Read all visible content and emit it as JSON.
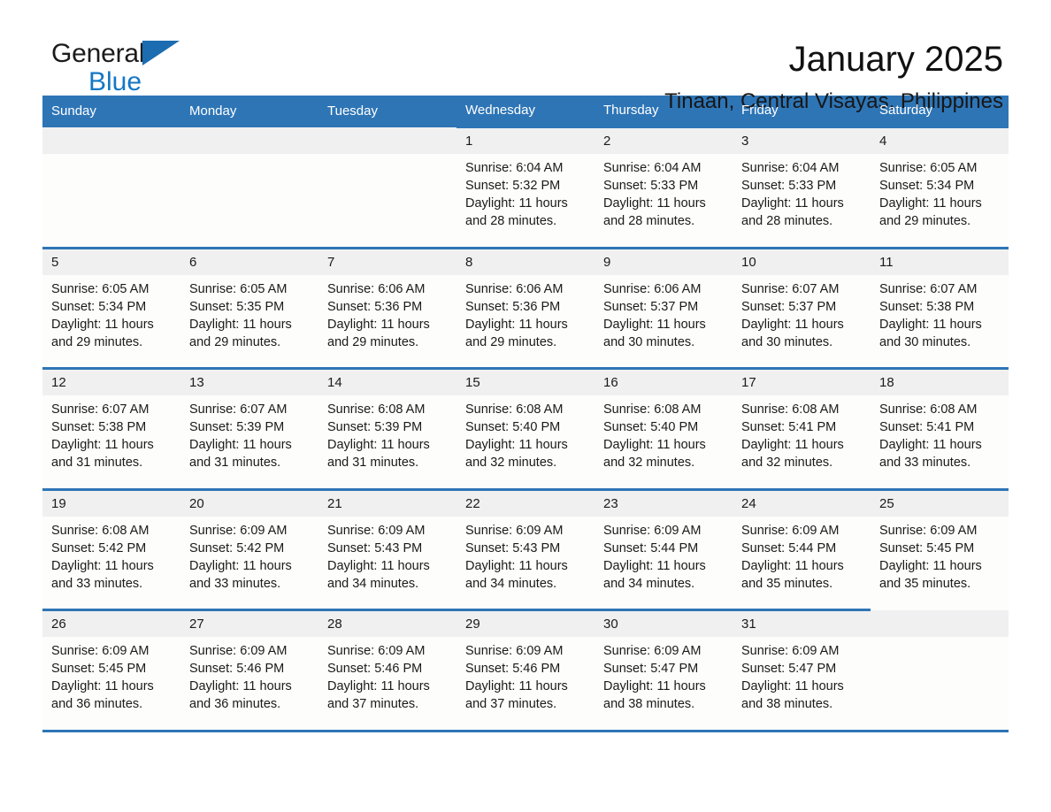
{
  "brand": {
    "name_first": "General",
    "name_second": "Blue",
    "logo_color": "#1b6cb0",
    "text_color": "#1577c4"
  },
  "header": {
    "title": "January 2025",
    "subtitle": "Tinaan, Central Visayas, Philippines"
  },
  "theme": {
    "header_blue": "#2e75b6",
    "daynum_background": "#f0f0f0",
    "cell_background": "#fdfdfc"
  },
  "weekday_headers": [
    "Sunday",
    "Monday",
    "Tuesday",
    "Wednesday",
    "Thursday",
    "Friday",
    "Saturday"
  ],
  "weeks": [
    [
      {
        "day": "",
        "sunrise": "",
        "sunset": "",
        "daylight_1": "",
        "daylight_2": ""
      },
      {
        "day": "",
        "sunrise": "",
        "sunset": "",
        "daylight_1": "",
        "daylight_2": ""
      },
      {
        "day": "",
        "sunrise": "",
        "sunset": "",
        "daylight_1": "",
        "daylight_2": ""
      },
      {
        "day": "1",
        "sunrise": "Sunrise: 6:04 AM",
        "sunset": "Sunset: 5:32 PM",
        "daylight_1": "Daylight: 11 hours",
        "daylight_2": "and 28 minutes."
      },
      {
        "day": "2",
        "sunrise": "Sunrise: 6:04 AM",
        "sunset": "Sunset: 5:33 PM",
        "daylight_1": "Daylight: 11 hours",
        "daylight_2": "and 28 minutes."
      },
      {
        "day": "3",
        "sunrise": "Sunrise: 6:04 AM",
        "sunset": "Sunset: 5:33 PM",
        "daylight_1": "Daylight: 11 hours",
        "daylight_2": "and 28 minutes."
      },
      {
        "day": "4",
        "sunrise": "Sunrise: 6:05 AM",
        "sunset": "Sunset: 5:34 PM",
        "daylight_1": "Daylight: 11 hours",
        "daylight_2": "and 29 minutes."
      }
    ],
    [
      {
        "day": "5",
        "sunrise": "Sunrise: 6:05 AM",
        "sunset": "Sunset: 5:34 PM",
        "daylight_1": "Daylight: 11 hours",
        "daylight_2": "and 29 minutes."
      },
      {
        "day": "6",
        "sunrise": "Sunrise: 6:05 AM",
        "sunset": "Sunset: 5:35 PM",
        "daylight_1": "Daylight: 11 hours",
        "daylight_2": "and 29 minutes."
      },
      {
        "day": "7",
        "sunrise": "Sunrise: 6:06 AM",
        "sunset": "Sunset: 5:36 PM",
        "daylight_1": "Daylight: 11 hours",
        "daylight_2": "and 29 minutes."
      },
      {
        "day": "8",
        "sunrise": "Sunrise: 6:06 AM",
        "sunset": "Sunset: 5:36 PM",
        "daylight_1": "Daylight: 11 hours",
        "daylight_2": "and 29 minutes."
      },
      {
        "day": "9",
        "sunrise": "Sunrise: 6:06 AM",
        "sunset": "Sunset: 5:37 PM",
        "daylight_1": "Daylight: 11 hours",
        "daylight_2": "and 30 minutes."
      },
      {
        "day": "10",
        "sunrise": "Sunrise: 6:07 AM",
        "sunset": "Sunset: 5:37 PM",
        "daylight_1": "Daylight: 11 hours",
        "daylight_2": "and 30 minutes."
      },
      {
        "day": "11",
        "sunrise": "Sunrise: 6:07 AM",
        "sunset": "Sunset: 5:38 PM",
        "daylight_1": "Daylight: 11 hours",
        "daylight_2": "and 30 minutes."
      }
    ],
    [
      {
        "day": "12",
        "sunrise": "Sunrise: 6:07 AM",
        "sunset": "Sunset: 5:38 PM",
        "daylight_1": "Daylight: 11 hours",
        "daylight_2": "and 31 minutes."
      },
      {
        "day": "13",
        "sunrise": "Sunrise: 6:07 AM",
        "sunset": "Sunset: 5:39 PM",
        "daylight_1": "Daylight: 11 hours",
        "daylight_2": "and 31 minutes."
      },
      {
        "day": "14",
        "sunrise": "Sunrise: 6:08 AM",
        "sunset": "Sunset: 5:39 PM",
        "daylight_1": "Daylight: 11 hours",
        "daylight_2": "and 31 minutes."
      },
      {
        "day": "15",
        "sunrise": "Sunrise: 6:08 AM",
        "sunset": "Sunset: 5:40 PM",
        "daylight_1": "Daylight: 11 hours",
        "daylight_2": "and 32 minutes."
      },
      {
        "day": "16",
        "sunrise": "Sunrise: 6:08 AM",
        "sunset": "Sunset: 5:40 PM",
        "daylight_1": "Daylight: 11 hours",
        "daylight_2": "and 32 minutes."
      },
      {
        "day": "17",
        "sunrise": "Sunrise: 6:08 AM",
        "sunset": "Sunset: 5:41 PM",
        "daylight_1": "Daylight: 11 hours",
        "daylight_2": "and 32 minutes."
      },
      {
        "day": "18",
        "sunrise": "Sunrise: 6:08 AM",
        "sunset": "Sunset: 5:41 PM",
        "daylight_1": "Daylight: 11 hours",
        "daylight_2": "and 33 minutes."
      }
    ],
    [
      {
        "day": "19",
        "sunrise": "Sunrise: 6:08 AM",
        "sunset": "Sunset: 5:42 PM",
        "daylight_1": "Daylight: 11 hours",
        "daylight_2": "and 33 minutes."
      },
      {
        "day": "20",
        "sunrise": "Sunrise: 6:09 AM",
        "sunset": "Sunset: 5:42 PM",
        "daylight_1": "Daylight: 11 hours",
        "daylight_2": "and 33 minutes."
      },
      {
        "day": "21",
        "sunrise": "Sunrise: 6:09 AM",
        "sunset": "Sunset: 5:43 PM",
        "daylight_1": "Daylight: 11 hours",
        "daylight_2": "and 34 minutes."
      },
      {
        "day": "22",
        "sunrise": "Sunrise: 6:09 AM",
        "sunset": "Sunset: 5:43 PM",
        "daylight_1": "Daylight: 11 hours",
        "daylight_2": "and 34 minutes."
      },
      {
        "day": "23",
        "sunrise": "Sunrise: 6:09 AM",
        "sunset": "Sunset: 5:44 PM",
        "daylight_1": "Daylight: 11 hours",
        "daylight_2": "and 34 minutes."
      },
      {
        "day": "24",
        "sunrise": "Sunrise: 6:09 AM",
        "sunset": "Sunset: 5:44 PM",
        "daylight_1": "Daylight: 11 hours",
        "daylight_2": "and 35 minutes."
      },
      {
        "day": "25",
        "sunrise": "Sunrise: 6:09 AM",
        "sunset": "Sunset: 5:45 PM",
        "daylight_1": "Daylight: 11 hours",
        "daylight_2": "and 35 minutes."
      }
    ],
    [
      {
        "day": "26",
        "sunrise": "Sunrise: 6:09 AM",
        "sunset": "Sunset: 5:45 PM",
        "daylight_1": "Daylight: 11 hours",
        "daylight_2": "and 36 minutes."
      },
      {
        "day": "27",
        "sunrise": "Sunrise: 6:09 AM",
        "sunset": "Sunset: 5:46 PM",
        "daylight_1": "Daylight: 11 hours",
        "daylight_2": "and 36 minutes."
      },
      {
        "day": "28",
        "sunrise": "Sunrise: 6:09 AM",
        "sunset": "Sunset: 5:46 PM",
        "daylight_1": "Daylight: 11 hours",
        "daylight_2": "and 37 minutes."
      },
      {
        "day": "29",
        "sunrise": "Sunrise: 6:09 AM",
        "sunset": "Sunset: 5:46 PM",
        "daylight_1": "Daylight: 11 hours",
        "daylight_2": "and 37 minutes."
      },
      {
        "day": "30",
        "sunrise": "Sunrise: 6:09 AM",
        "sunset": "Sunset: 5:47 PM",
        "daylight_1": "Daylight: 11 hours",
        "daylight_2": "and 38 minutes."
      },
      {
        "day": "31",
        "sunrise": "Sunrise: 6:09 AM",
        "sunset": "Sunset: 5:47 PM",
        "daylight_1": "Daylight: 11 hours",
        "daylight_2": "and 38 minutes."
      },
      {
        "day": "",
        "sunrise": "",
        "sunset": "",
        "daylight_1": "",
        "daylight_2": ""
      }
    ]
  ]
}
